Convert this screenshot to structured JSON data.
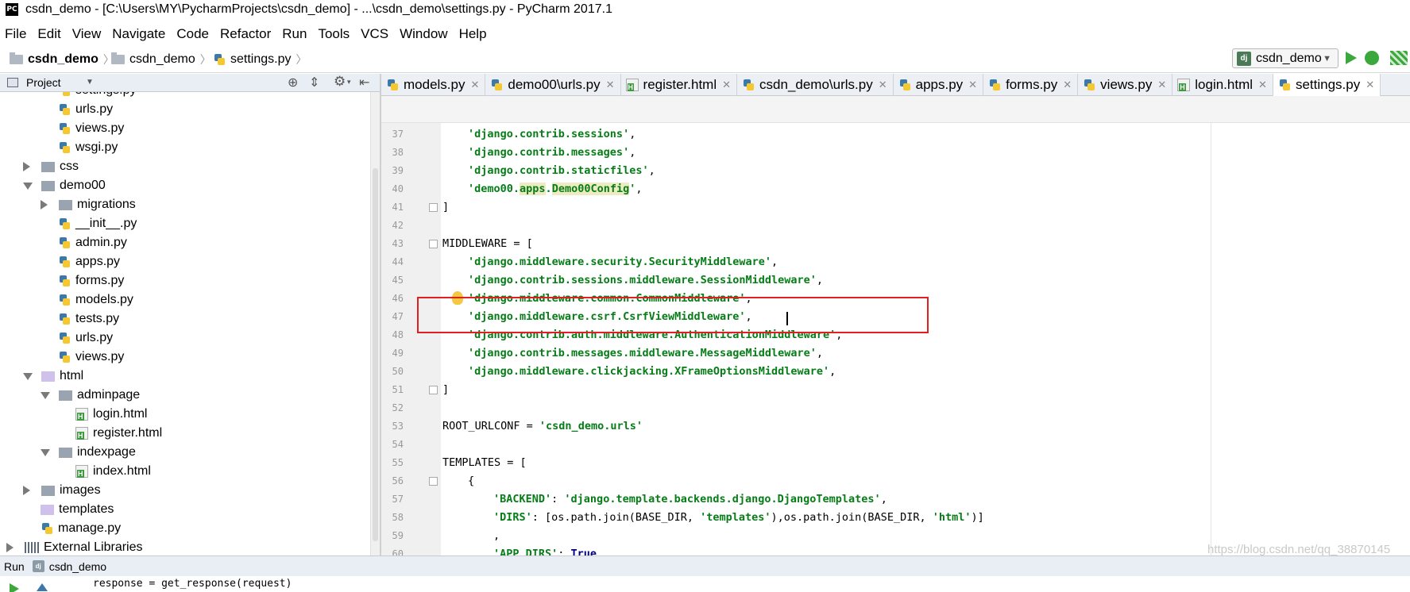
{
  "window": {
    "title": "csdn_demo - [C:\\Users\\MY\\PycharmProjects\\csdn_demo] - ...\\csdn_demo\\settings.py - PyCharm 2017.1",
    "app_icon": "PC"
  },
  "menu": [
    "File",
    "Edit",
    "View",
    "Navigate",
    "Code",
    "Refactor",
    "Run",
    "Tools",
    "VCS",
    "Window",
    "Help"
  ],
  "breadcrumb": [
    "csdn_demo",
    "csdn_demo",
    "settings.py"
  ],
  "run_config": {
    "label": "csdn_demo",
    "icon": "dj"
  },
  "project_panel": {
    "title": "Project"
  },
  "tree": [
    {
      "label": "settings.py",
      "type": "py",
      "depth": 3,
      "arrow": "none",
      "partial": true
    },
    {
      "label": "urls.py",
      "type": "py",
      "depth": 3,
      "arrow": "none"
    },
    {
      "label": "views.py",
      "type": "py",
      "depth": 3,
      "arrow": "none"
    },
    {
      "label": "wsgi.py",
      "type": "py",
      "depth": 3,
      "arrow": "none"
    },
    {
      "label": "css",
      "type": "folder",
      "depth": 1,
      "arrow": "right"
    },
    {
      "label": "demo00",
      "type": "folder",
      "depth": 1,
      "arrow": "down"
    },
    {
      "label": "migrations",
      "type": "folder",
      "depth": 2,
      "arrow": "right"
    },
    {
      "label": "__init__.py",
      "type": "py",
      "depth": 3,
      "arrow": "none"
    },
    {
      "label": "admin.py",
      "type": "py",
      "depth": 3,
      "arrow": "none"
    },
    {
      "label": "apps.py",
      "type": "py",
      "depth": 3,
      "arrow": "none"
    },
    {
      "label": "forms.py",
      "type": "py",
      "depth": 3,
      "arrow": "none"
    },
    {
      "label": "models.py",
      "type": "py",
      "depth": 3,
      "arrow": "none"
    },
    {
      "label": "tests.py",
      "type": "py",
      "depth": 3,
      "arrow": "none"
    },
    {
      "label": "urls.py",
      "type": "py",
      "depth": 3,
      "arrow": "none"
    },
    {
      "label": "views.py",
      "type": "py",
      "depth": 3,
      "arrow": "none"
    },
    {
      "label": "html",
      "type": "folder-purple",
      "depth": 1,
      "arrow": "down"
    },
    {
      "label": "adminpage",
      "type": "folder",
      "depth": 2,
      "arrow": "down"
    },
    {
      "label": "login.html",
      "type": "html",
      "depth": 4,
      "arrow": "none"
    },
    {
      "label": "register.html",
      "type": "html",
      "depth": 4,
      "arrow": "none"
    },
    {
      "label": "indexpage",
      "type": "folder",
      "depth": 2,
      "arrow": "down"
    },
    {
      "label": "index.html",
      "type": "html",
      "depth": 4,
      "arrow": "none"
    },
    {
      "label": "images",
      "type": "folder",
      "depth": 1,
      "arrow": "right"
    },
    {
      "label": "templates",
      "type": "folder-purple",
      "depth": 2,
      "arrow": "none"
    },
    {
      "label": "manage.py",
      "type": "py",
      "depth": 2,
      "arrow": "none"
    },
    {
      "label": "External Libraries",
      "type": "libs",
      "depth": 0,
      "arrow": "right"
    }
  ],
  "tabs": [
    {
      "label": "models.py",
      "type": "py",
      "active": false
    },
    {
      "label": "demo00\\urls.py",
      "type": "py",
      "active": false
    },
    {
      "label": "register.html",
      "type": "html",
      "active": false
    },
    {
      "label": "csdn_demo\\urls.py",
      "type": "py",
      "active": false
    },
    {
      "label": "apps.py",
      "type": "py",
      "active": false
    },
    {
      "label": "forms.py",
      "type": "py",
      "active": false
    },
    {
      "label": "views.py",
      "type": "py",
      "active": false
    },
    {
      "label": "login.html",
      "type": "html",
      "active": false
    },
    {
      "label": "settings.py",
      "type": "py",
      "active": true
    }
  ],
  "code_lines": [
    {
      "num": "37",
      "indent": 1,
      "parts": [
        [
          "s",
          "'django.contrib.sessions'"
        ],
        [
          "p",
          ","
        ]
      ]
    },
    {
      "num": "38",
      "indent": 1,
      "parts": [
        [
          "s",
          "'django.contrib.messages'"
        ],
        [
          "p",
          ","
        ]
      ]
    },
    {
      "num": "39",
      "indent": 1,
      "parts": [
        [
          "s",
          "'django.contrib.staticfiles'"
        ],
        [
          "p",
          ","
        ]
      ]
    },
    {
      "num": "40",
      "indent": 1,
      "parts": [
        [
          "s",
          "'demo00."
        ],
        [
          "sh",
          "apps"
        ],
        [
          "s",
          "."
        ],
        [
          "sh",
          "Demo00Config"
        ],
        [
          "s",
          "'"
        ],
        [
          "p",
          ","
        ]
      ]
    },
    {
      "num": "41",
      "indent": 0,
      "parts": [
        [
          "p",
          "]"
        ]
      ]
    },
    {
      "num": "42",
      "indent": 0,
      "parts": []
    },
    {
      "num": "43",
      "indent": 0,
      "parts": [
        [
          "p",
          "MIDDLEWARE = ["
        ]
      ]
    },
    {
      "num": "44",
      "indent": 1,
      "parts": [
        [
          "s",
          "'django.middleware.security.SecurityMiddleware'"
        ],
        [
          "p",
          ","
        ]
      ]
    },
    {
      "num": "45",
      "indent": 1,
      "parts": [
        [
          "s",
          "'django.contrib.sessions.middleware.SessionMiddleware'"
        ],
        [
          "p",
          ","
        ]
      ]
    },
    {
      "num": "46",
      "indent": 1,
      "parts": [
        [
          "s",
          "'django.middleware.common.CommonMiddleware'"
        ],
        [
          "p",
          ","
        ]
      ]
    },
    {
      "num": "47",
      "indent": 1,
      "parts": [
        [
          "s",
          "'django.middleware.csrf.CsrfViewMiddleware'"
        ],
        [
          "p",
          ","
        ]
      ]
    },
    {
      "num": "48",
      "indent": 1,
      "parts": [
        [
          "s",
          "'django.contrib.auth.middleware.AuthenticationMiddleware'"
        ],
        [
          "p",
          ","
        ]
      ]
    },
    {
      "num": "49",
      "indent": 1,
      "parts": [
        [
          "s",
          "'django.contrib.messages.middleware.MessageMiddleware'"
        ],
        [
          "p",
          ","
        ]
      ]
    },
    {
      "num": "50",
      "indent": 1,
      "parts": [
        [
          "s",
          "'django.middleware.clickjacking.XFrameOptionsMiddleware'"
        ],
        [
          "p",
          ","
        ]
      ]
    },
    {
      "num": "51",
      "indent": 0,
      "parts": [
        [
          "p",
          "]"
        ]
      ]
    },
    {
      "num": "52",
      "indent": 0,
      "parts": []
    },
    {
      "num": "53",
      "indent": 0,
      "parts": [
        [
          "p",
          "ROOT_URLCONF = "
        ],
        [
          "s",
          "'csdn_demo.urls'"
        ]
      ]
    },
    {
      "num": "54",
      "indent": 0,
      "parts": []
    },
    {
      "num": "55",
      "indent": 0,
      "parts": [
        [
          "p",
          "TEMPLATES = ["
        ]
      ]
    },
    {
      "num": "56",
      "indent": 1,
      "parts": [
        [
          "p",
          "{"
        ]
      ]
    },
    {
      "num": "57",
      "indent": 2,
      "parts": [
        [
          "s",
          "'BACKEND'"
        ],
        [
          "p",
          ": "
        ],
        [
          "s",
          "'django.template.backends.django.DjangoTemplates'"
        ],
        [
          "p",
          ","
        ]
      ]
    },
    {
      "num": "58",
      "indent": 2,
      "parts": [
        [
          "s",
          "'DIRS'"
        ],
        [
          "p",
          ": [os.path.join(BASE_DIR, "
        ],
        [
          "s",
          "'templates'"
        ],
        [
          "p",
          "),os.path.join(BASE_DIR, "
        ],
        [
          "s",
          "'html'"
        ],
        [
          "p",
          ")]"
        ]
      ]
    },
    {
      "num": "59",
      "indent": 2,
      "parts": [
        [
          "p",
          ","
        ]
      ]
    },
    {
      "num": "60",
      "indent": 2,
      "parts": [
        [
          "s",
          "'APP_DIRS'"
        ],
        [
          "p",
          ": "
        ],
        [
          "k",
          "True"
        ],
        [
          "p",
          ","
        ]
      ]
    }
  ],
  "run_panel": {
    "label": "Run",
    "config": "csdn_demo"
  },
  "console_output": "response = get_response(request)",
  "watermark": "https://blog.csdn.net/qq_38870145",
  "colors": {
    "string": "#067d17",
    "keyword": "#000080",
    "highlight_box": "#e02020",
    "caret_line": "#fcfbea"
  }
}
